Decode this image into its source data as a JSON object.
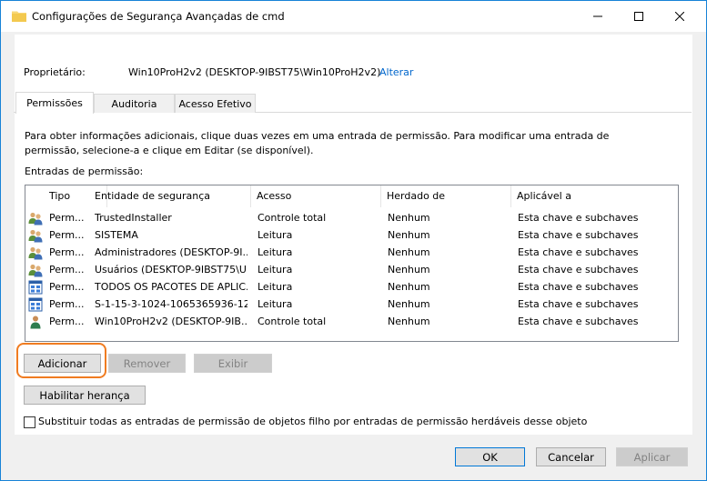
{
  "window": {
    "title": "Configurações de Segurança Avançadas de cmd"
  },
  "owner": {
    "label": "Proprietário:",
    "value": "Win10ProH2v2 (DESKTOP-9IBST75\\Win10ProH2v2)",
    "change_link": "Alterar"
  },
  "tabs": [
    {
      "label": "Permissões",
      "active": true
    },
    {
      "label": "Auditoria",
      "active": false
    },
    {
      "label": "Acesso Efetivo",
      "active": false
    }
  ],
  "info_text": "Para obter informações adicionais, clique duas vezes em uma entrada de permissão. Para modificar uma entrada de permissão, selecione-a e clique em Editar (se disponível).",
  "entries_label": "Entradas de permissão:",
  "table": {
    "columns": [
      "Tipo",
      "Entidade de segurança",
      "Acesso",
      "Herdado de",
      "Aplicável a"
    ],
    "rows": [
      {
        "icon": "group-users-icon",
        "tipo": "Perm...",
        "entidade": "TrustedInstaller",
        "acesso": "Controle total",
        "herdado": "Nenhum",
        "aplicavel": "Esta chave e subchaves"
      },
      {
        "icon": "group-users-icon",
        "tipo": "Perm...",
        "entidade": "SISTEMA",
        "acesso": "Leitura",
        "herdado": "Nenhum",
        "aplicavel": "Esta chave e subchaves"
      },
      {
        "icon": "group-users-icon",
        "tipo": "Perm...",
        "entidade": "Administradores (DESKTOP-9I...",
        "acesso": "Leitura",
        "herdado": "Nenhum",
        "aplicavel": "Esta chave e subchaves"
      },
      {
        "icon": "group-users-icon",
        "tipo": "Perm...",
        "entidade": "Usuários (DESKTOP-9IBST75\\U...",
        "acesso": "Leitura",
        "herdado": "Nenhum",
        "aplicavel": "Esta chave e subchaves"
      },
      {
        "icon": "app-package-icon",
        "tipo": "Perm...",
        "entidade": "TODOS OS PACOTES DE APLIC...",
        "acesso": "Leitura",
        "herdado": "Nenhum",
        "aplicavel": "Esta chave e subchaves"
      },
      {
        "icon": "app-package-icon",
        "tipo": "Perm...",
        "entidade": "S-1-15-3-1024-1065365936-12...",
        "acesso": "Leitura",
        "herdado": "Nenhum",
        "aplicavel": "Esta chave e subchaves"
      },
      {
        "icon": "single-user-icon",
        "tipo": "Perm...",
        "entidade": "Win10ProH2v2 (DESKTOP-9IB...",
        "acesso": "Controle total",
        "herdado": "Nenhum",
        "aplicavel": "Esta chave e subchaves"
      }
    ]
  },
  "buttons": {
    "add": "Adicionar",
    "remove": "Remover",
    "view": "Exibir",
    "enable_inheritance": "Habilitar herança",
    "ok": "OK",
    "cancel": "Cancelar",
    "apply": "Aplicar"
  },
  "checkbox": {
    "label": "Substituir todas as entradas de permissão de objetos filho por entradas de permissão herdáveis desse objeto",
    "checked": false
  },
  "colors": {
    "accent": "#0078d7",
    "highlight": "#f07c21",
    "link": "#0066cc"
  }
}
